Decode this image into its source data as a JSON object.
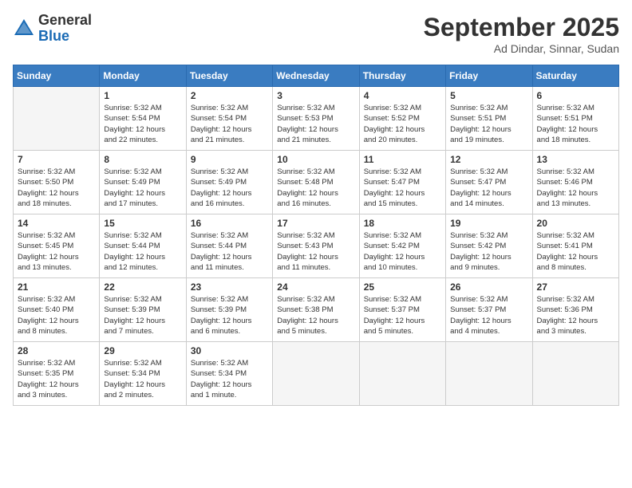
{
  "logo": {
    "general": "General",
    "blue": "Blue"
  },
  "header": {
    "month": "September 2025",
    "location": "Ad Dindar, Sinnar, Sudan"
  },
  "days_of_week": [
    "Sunday",
    "Monday",
    "Tuesday",
    "Wednesday",
    "Thursday",
    "Friday",
    "Saturday"
  ],
  "weeks": [
    [
      {
        "day": "",
        "info": "",
        "empty": true
      },
      {
        "day": "1",
        "info": "Sunrise: 5:32 AM\nSunset: 5:54 PM\nDaylight: 12 hours\nand 22 minutes."
      },
      {
        "day": "2",
        "info": "Sunrise: 5:32 AM\nSunset: 5:54 PM\nDaylight: 12 hours\nand 21 minutes."
      },
      {
        "day": "3",
        "info": "Sunrise: 5:32 AM\nSunset: 5:53 PM\nDaylight: 12 hours\nand 21 minutes."
      },
      {
        "day": "4",
        "info": "Sunrise: 5:32 AM\nSunset: 5:52 PM\nDaylight: 12 hours\nand 20 minutes."
      },
      {
        "day": "5",
        "info": "Sunrise: 5:32 AM\nSunset: 5:51 PM\nDaylight: 12 hours\nand 19 minutes."
      },
      {
        "day": "6",
        "info": "Sunrise: 5:32 AM\nSunset: 5:51 PM\nDaylight: 12 hours\nand 18 minutes."
      }
    ],
    [
      {
        "day": "7",
        "info": "Sunrise: 5:32 AM\nSunset: 5:50 PM\nDaylight: 12 hours\nand 18 minutes."
      },
      {
        "day": "8",
        "info": "Sunrise: 5:32 AM\nSunset: 5:49 PM\nDaylight: 12 hours\nand 17 minutes."
      },
      {
        "day": "9",
        "info": "Sunrise: 5:32 AM\nSunset: 5:49 PM\nDaylight: 12 hours\nand 16 minutes."
      },
      {
        "day": "10",
        "info": "Sunrise: 5:32 AM\nSunset: 5:48 PM\nDaylight: 12 hours\nand 16 minutes."
      },
      {
        "day": "11",
        "info": "Sunrise: 5:32 AM\nSunset: 5:47 PM\nDaylight: 12 hours\nand 15 minutes."
      },
      {
        "day": "12",
        "info": "Sunrise: 5:32 AM\nSunset: 5:47 PM\nDaylight: 12 hours\nand 14 minutes."
      },
      {
        "day": "13",
        "info": "Sunrise: 5:32 AM\nSunset: 5:46 PM\nDaylight: 12 hours\nand 13 minutes."
      }
    ],
    [
      {
        "day": "14",
        "info": "Sunrise: 5:32 AM\nSunset: 5:45 PM\nDaylight: 12 hours\nand 13 minutes."
      },
      {
        "day": "15",
        "info": "Sunrise: 5:32 AM\nSunset: 5:44 PM\nDaylight: 12 hours\nand 12 minutes."
      },
      {
        "day": "16",
        "info": "Sunrise: 5:32 AM\nSunset: 5:44 PM\nDaylight: 12 hours\nand 11 minutes."
      },
      {
        "day": "17",
        "info": "Sunrise: 5:32 AM\nSunset: 5:43 PM\nDaylight: 12 hours\nand 11 minutes."
      },
      {
        "day": "18",
        "info": "Sunrise: 5:32 AM\nSunset: 5:42 PM\nDaylight: 12 hours\nand 10 minutes."
      },
      {
        "day": "19",
        "info": "Sunrise: 5:32 AM\nSunset: 5:42 PM\nDaylight: 12 hours\nand 9 minutes."
      },
      {
        "day": "20",
        "info": "Sunrise: 5:32 AM\nSunset: 5:41 PM\nDaylight: 12 hours\nand 8 minutes."
      }
    ],
    [
      {
        "day": "21",
        "info": "Sunrise: 5:32 AM\nSunset: 5:40 PM\nDaylight: 12 hours\nand 8 minutes."
      },
      {
        "day": "22",
        "info": "Sunrise: 5:32 AM\nSunset: 5:39 PM\nDaylight: 12 hours\nand 7 minutes."
      },
      {
        "day": "23",
        "info": "Sunrise: 5:32 AM\nSunset: 5:39 PM\nDaylight: 12 hours\nand 6 minutes."
      },
      {
        "day": "24",
        "info": "Sunrise: 5:32 AM\nSunset: 5:38 PM\nDaylight: 12 hours\nand 5 minutes."
      },
      {
        "day": "25",
        "info": "Sunrise: 5:32 AM\nSunset: 5:37 PM\nDaylight: 12 hours\nand 5 minutes."
      },
      {
        "day": "26",
        "info": "Sunrise: 5:32 AM\nSunset: 5:37 PM\nDaylight: 12 hours\nand 4 minutes."
      },
      {
        "day": "27",
        "info": "Sunrise: 5:32 AM\nSunset: 5:36 PM\nDaylight: 12 hours\nand 3 minutes."
      }
    ],
    [
      {
        "day": "28",
        "info": "Sunrise: 5:32 AM\nSunset: 5:35 PM\nDaylight: 12 hours\nand 3 minutes."
      },
      {
        "day": "29",
        "info": "Sunrise: 5:32 AM\nSunset: 5:34 PM\nDaylight: 12 hours\nand 2 minutes."
      },
      {
        "day": "30",
        "info": "Sunrise: 5:32 AM\nSunset: 5:34 PM\nDaylight: 12 hours\nand 1 minute."
      },
      {
        "day": "",
        "info": "",
        "empty": true
      },
      {
        "day": "",
        "info": "",
        "empty": true
      },
      {
        "day": "",
        "info": "",
        "empty": true
      },
      {
        "day": "",
        "info": "",
        "empty": true
      }
    ]
  ]
}
